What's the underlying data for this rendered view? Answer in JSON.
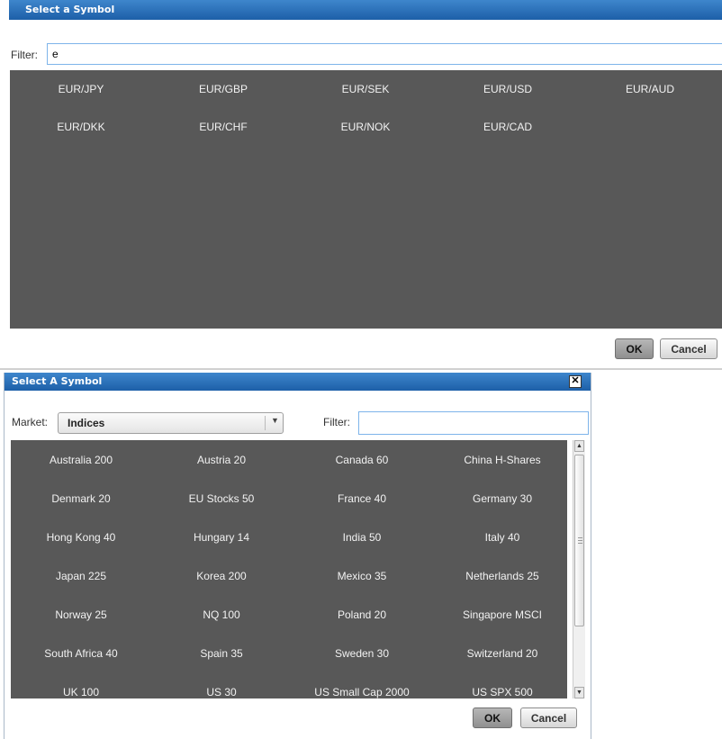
{
  "dialog1": {
    "title": "Select a Symbol",
    "filter_label": "Filter:",
    "filter_value": "e",
    "symbols": [
      "EUR/JPY",
      "EUR/GBP",
      "EUR/SEK",
      "EUR/USD",
      "EUR/AUD",
      "EUR/DKK",
      "EUR/CHF",
      "EUR/NOK",
      "EUR/CAD"
    ],
    "ok_label": "OK",
    "cancel_label": "Cancel"
  },
  "dialog2": {
    "title": "Select A Symbol",
    "close_glyph": "✕",
    "market_label": "Market:",
    "market_value": "Indices",
    "filter_label": "Filter:",
    "filter_value": "",
    "symbols": [
      "Australia 200",
      "Austria 20",
      "Canada 60",
      "China H-Shares",
      "Denmark 20",
      "EU Stocks 50",
      "France 40",
      "Germany 30",
      "Hong Kong 40",
      "Hungary 14",
      "India 50",
      "Italy 40",
      "Japan 225",
      "Korea 200",
      "Mexico 35",
      "Netherlands 25",
      "Norway 25",
      "NQ 100",
      "Poland 20",
      "Singapore MSCI",
      "South Africa 40",
      "Spain 35",
      "Sweden 30",
      "Switzerland 20",
      "UK 100",
      "US 30",
      "US Small Cap 2000",
      "US SPX 500"
    ],
    "ok_label": "OK",
    "cancel_label": "Cancel"
  },
  "icons": {
    "dropdown_arrow": "▼",
    "scroll_up": "▲",
    "scroll_down": "▼"
  }
}
